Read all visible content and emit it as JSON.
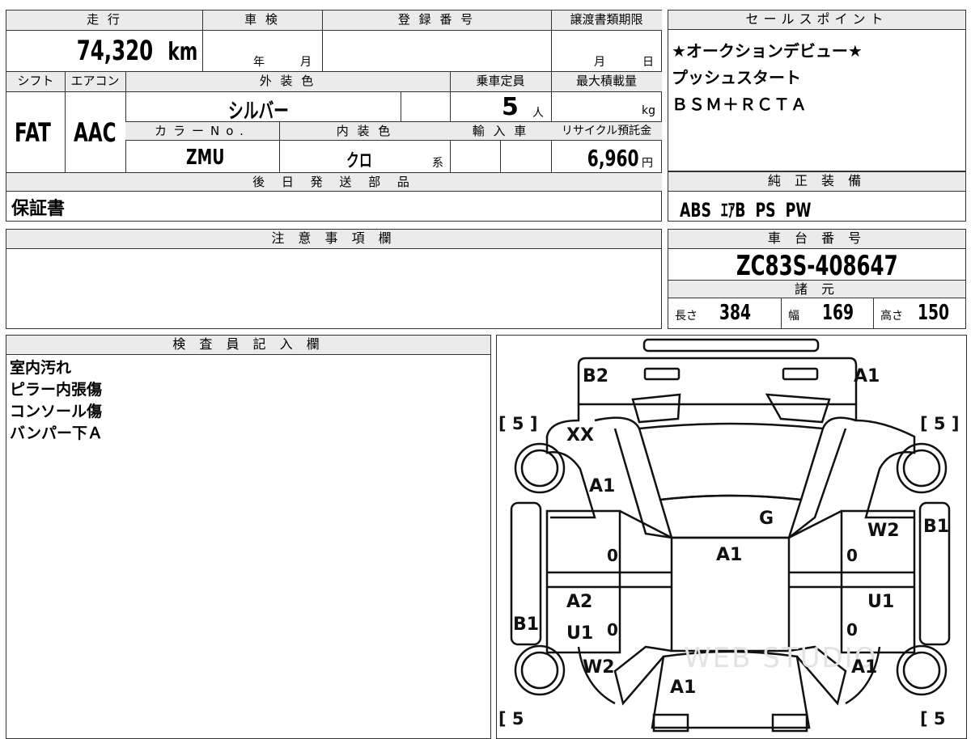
{
  "headers": {
    "mileage": "走 行",
    "shaken": "車 検",
    "registration": "登 録 番 号",
    "transfer_deadline": "譲渡書類期限",
    "sales_points": "セールスポイント",
    "shift": "シフト",
    "aircon": "エアコン",
    "exterior_color": "外 装 色",
    "capacity": "乗車定員",
    "max_load": "最大積載量",
    "color_no": "カラーNo.",
    "interior_color": "内 装 色",
    "import": "輸 入 車",
    "recycle_fee": "リサイクル預託金",
    "later_parts": "後 日 発 送 部 品",
    "standard_equipment": "純 正 装 備",
    "notes": "注 意 事 項 欄",
    "chassis": "車 台 番 号",
    "specs": "諸 元",
    "inspector": "検 査 員 記 入 欄"
  },
  "values": {
    "mileage": "74,320",
    "mileage_unit": "km",
    "shaken_year": "年",
    "shaken_month": "月",
    "transfer_month": "月",
    "transfer_day": "日",
    "shift": "FAT",
    "aircon": "AAC",
    "exterior_color": "シルバー",
    "capacity": "5",
    "capacity_unit": "人",
    "max_load_unit": "kg",
    "color_no": "ZMU",
    "interior_color": "クロ",
    "interior_suffix": "系",
    "recycle_fee": "6,960",
    "recycle_unit": "円",
    "later_parts": "保証書",
    "chassis": "ZC83S-408647"
  },
  "sales_points": [
    "★オークションデビュー★",
    "プッシュスタート",
    "ＢＳＭ＋ＲＣＴＡ"
  ],
  "standard_equipment": [
    "ABS",
    "ｴｱB",
    "PS",
    "PW"
  ],
  "specs": {
    "length_label": "長さ",
    "length": "384",
    "width_label": "幅",
    "width": "169",
    "height_label": "高さ",
    "height": "150"
  },
  "inspector_notes": [
    "室内汚れ",
    "ピラー内張傷",
    "コンソール傷",
    "バンパー下Ａ"
  ],
  "diagram": {
    "marks": {
      "rear_left": "B2",
      "rear_right": "A1",
      "quarter_left": "XX",
      "pillar_left": "A1",
      "roof_g": "G",
      "roof": "A1",
      "door_rr": "W2",
      "fender_right": "B1",
      "door_lf": "A2",
      "door_lf2": "U1",
      "rocker_left": "B1",
      "door_rf": "U1",
      "fender_lf": "W2",
      "fender_rf": "A1",
      "hood": "A1"
    },
    "tires": {
      "rl": "[ 5 ]",
      "rr": "[ 5 ]",
      "fl": "[ 5",
      "fr": "[ 5"
    },
    "zeros": [
      "0",
      "0",
      "0",
      "0"
    ],
    "watermark": "WEB STUDIO"
  }
}
